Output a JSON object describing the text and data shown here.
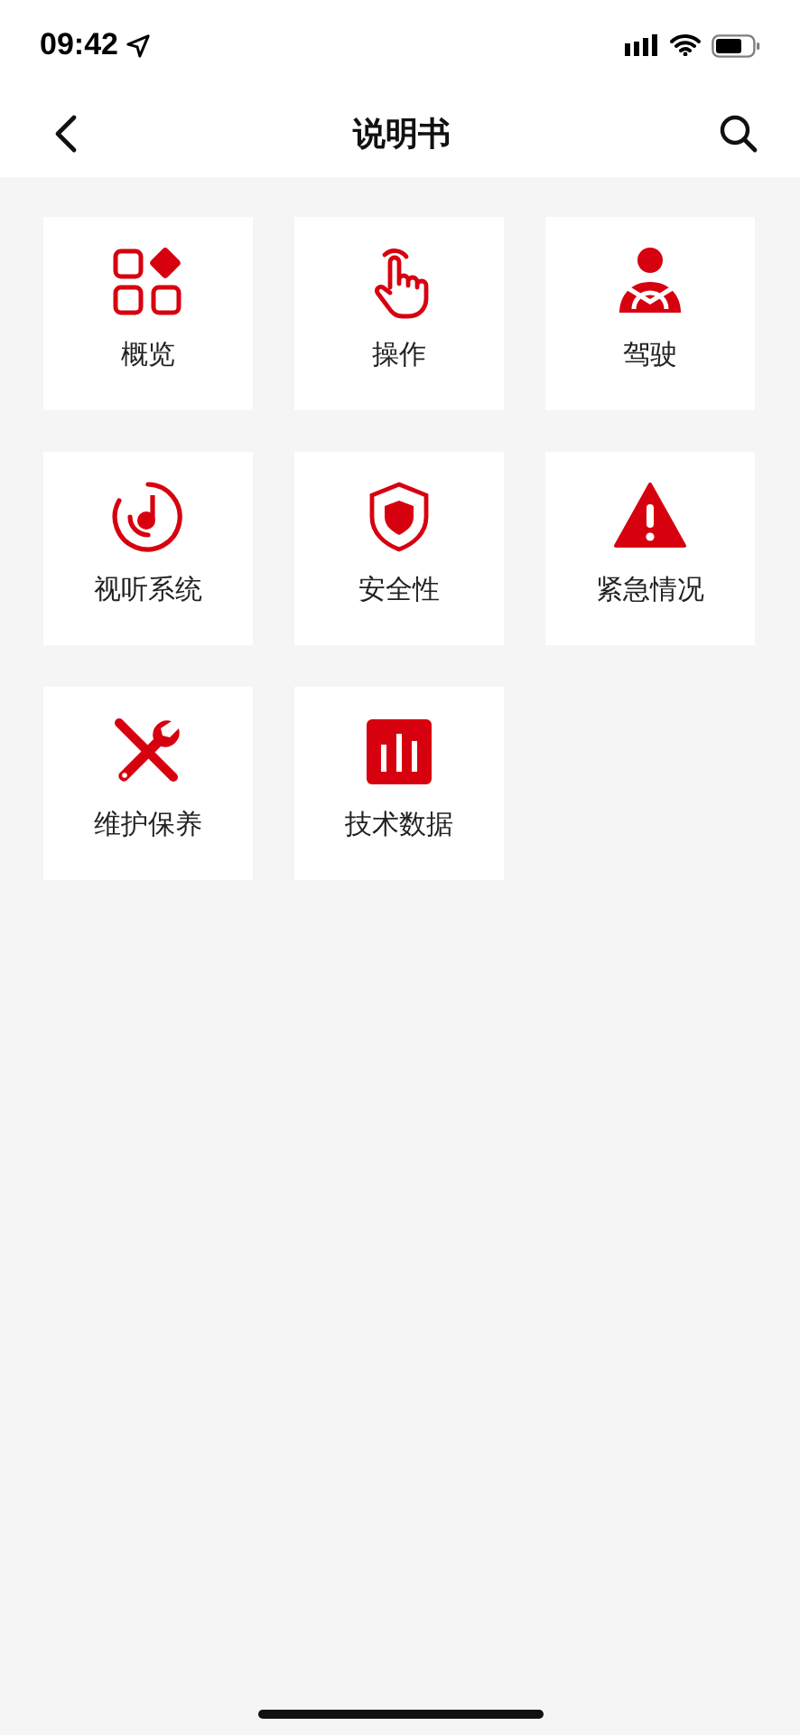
{
  "status_bar": {
    "time": "09:42"
  },
  "nav": {
    "title": "说明书"
  },
  "items": [
    {
      "label": "概览",
      "kind": "overview"
    },
    {
      "label": "操作",
      "kind": "operation"
    },
    {
      "label": "驾驶",
      "kind": "driving"
    },
    {
      "label": "视听系统",
      "kind": "audio"
    },
    {
      "label": "安全性",
      "kind": "safety"
    },
    {
      "label": "紧急情况",
      "kind": "emergency"
    },
    {
      "label": "维护保养",
      "kind": "maintenance"
    },
    {
      "label": "技术数据",
      "kind": "data"
    }
  ]
}
